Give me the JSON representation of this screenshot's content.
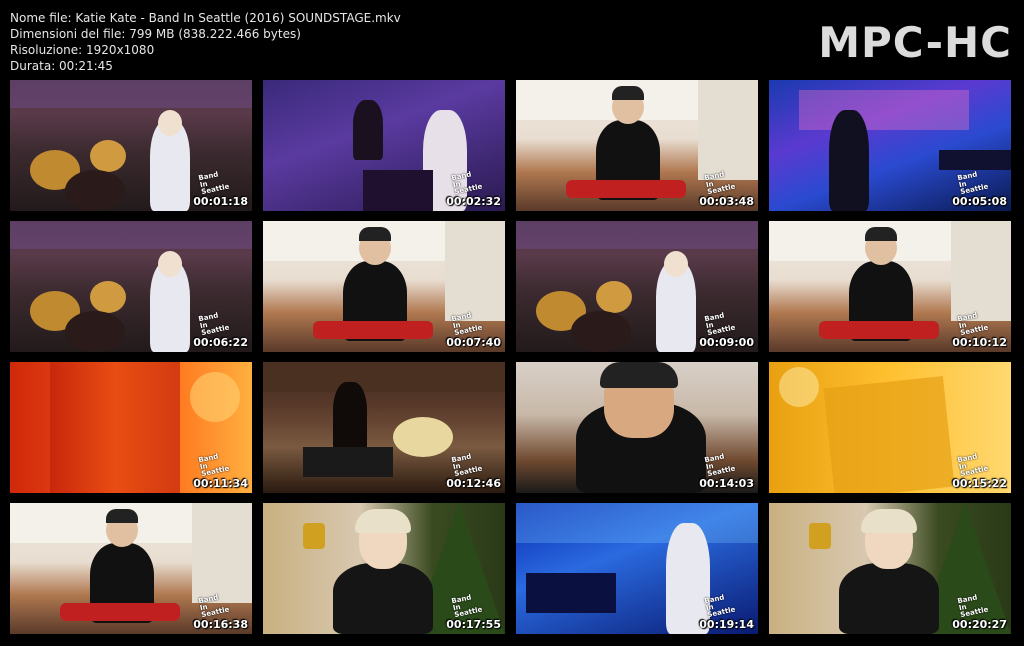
{
  "info": {
    "filename": "Nome file: Katie Kate - Band In Seattle (2016) SOUNDSTAGE.mkv",
    "filesize": "Dimensioni del file: 799 MB (838.222.466 bytes)",
    "resolution": "Risoluzione: 1920x1080",
    "duration": "Durata: 00:21:45"
  },
  "logo": "MPC-HC",
  "watermark": "Band In Seattle",
  "thumbnails": [
    {
      "time": "00:01:18",
      "scene": "drums"
    },
    {
      "time": "00:02:32",
      "scene": "purple"
    },
    {
      "time": "00:03:48",
      "scene": "kitchen"
    },
    {
      "time": "00:05:08",
      "scene": "blue"
    },
    {
      "time": "00:06:22",
      "scene": "drums"
    },
    {
      "time": "00:07:40",
      "scene": "kitchen"
    },
    {
      "time": "00:09:00",
      "scene": "drums"
    },
    {
      "time": "00:10:12",
      "scene": "kitchen"
    },
    {
      "time": "00:11:34",
      "scene": "orange"
    },
    {
      "time": "00:12:46",
      "scene": "brown"
    },
    {
      "time": "00:14:03",
      "scene": "closeup"
    },
    {
      "time": "00:15:22",
      "scene": "yellow"
    },
    {
      "time": "00:16:38",
      "scene": "kitchen"
    },
    {
      "time": "00:17:55",
      "scene": "xmas"
    },
    {
      "time": "00:19:14",
      "scene": "stage"
    },
    {
      "time": "00:20:27",
      "scene": "xmas"
    }
  ]
}
